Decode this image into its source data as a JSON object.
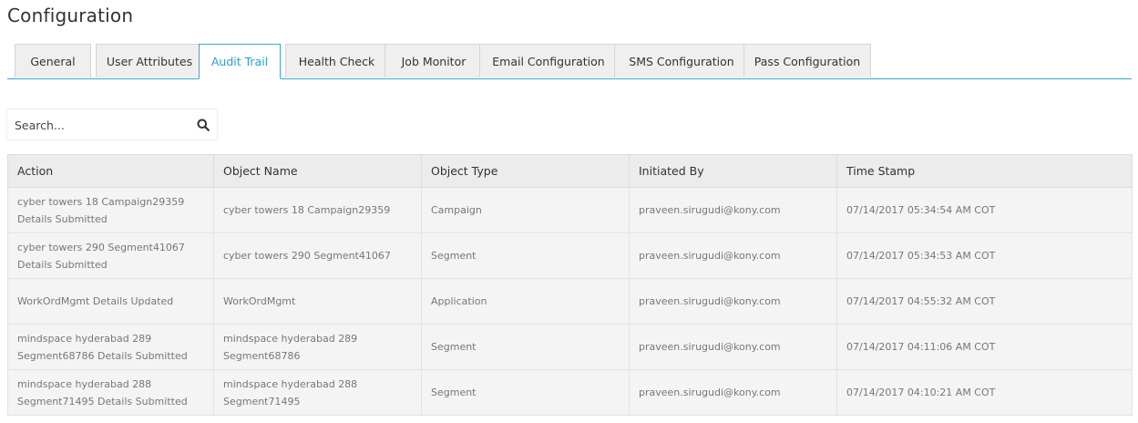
{
  "page": {
    "title": "Configuration"
  },
  "tabs": [
    {
      "label": "General"
    },
    {
      "label": "User Attributes"
    },
    {
      "label": "Audit Trail"
    },
    {
      "label": "Health Check"
    },
    {
      "label": "Job Monitor"
    },
    {
      "label": "Email Configuration"
    },
    {
      "label": "SMS Configuration"
    },
    {
      "label": "Pass Configuration"
    }
  ],
  "active_tab": "Audit Trail",
  "search": {
    "placeholder": "Search...",
    "value": "",
    "icon": "search-icon"
  },
  "table": {
    "columns": [
      "Action",
      "Object Name",
      "Object Type",
      "Initiated By",
      "Time Stamp"
    ],
    "rows": [
      {
        "action": "cyber towers 18 Campaign29359 Details Submitted",
        "object_name": "cyber towers 18 Campaign29359",
        "object_type": "Campaign",
        "initiated_by": "praveen.sirugudi@kony.com",
        "time_stamp": "07/14/2017 05:34:54 AM COT"
      },
      {
        "action": "cyber towers 290 Segment41067 Details Submitted",
        "object_name": "cyber towers 290 Segment41067",
        "object_type": "Segment",
        "initiated_by": "praveen.sirugudi@kony.com",
        "time_stamp": "07/14/2017 05:34:53 AM COT"
      },
      {
        "action": "WorkOrdMgmt Details Updated",
        "object_name": "WorkOrdMgmt",
        "object_type": "Application",
        "initiated_by": "praveen.sirugudi@kony.com",
        "time_stamp": "07/14/2017 04:55:32 AM COT"
      },
      {
        "action": "mindspace hyderabad 289 Segment68786 Details Submitted",
        "object_name": "mindspace hyderabad 289 Segment68786",
        "object_type": "Segment",
        "initiated_by": "praveen.sirugudi@kony.com",
        "time_stamp": "07/14/2017 04:11:06 AM COT"
      },
      {
        "action": "mindspace hyderabad 288 Segment71495 Details Submitted",
        "object_name": "mindspace hyderabad 288 Segment71495",
        "object_type": "Segment",
        "initiated_by": "praveen.sirugudi@kony.com",
        "time_stamp": "07/14/2017 04:10:21 AM COT"
      }
    ]
  },
  "colors": {
    "accent": "#2a9fd0",
    "tab_border_active": "#39a8c9",
    "header_bg": "#ececec",
    "row_bg": "#f4f4f4"
  }
}
